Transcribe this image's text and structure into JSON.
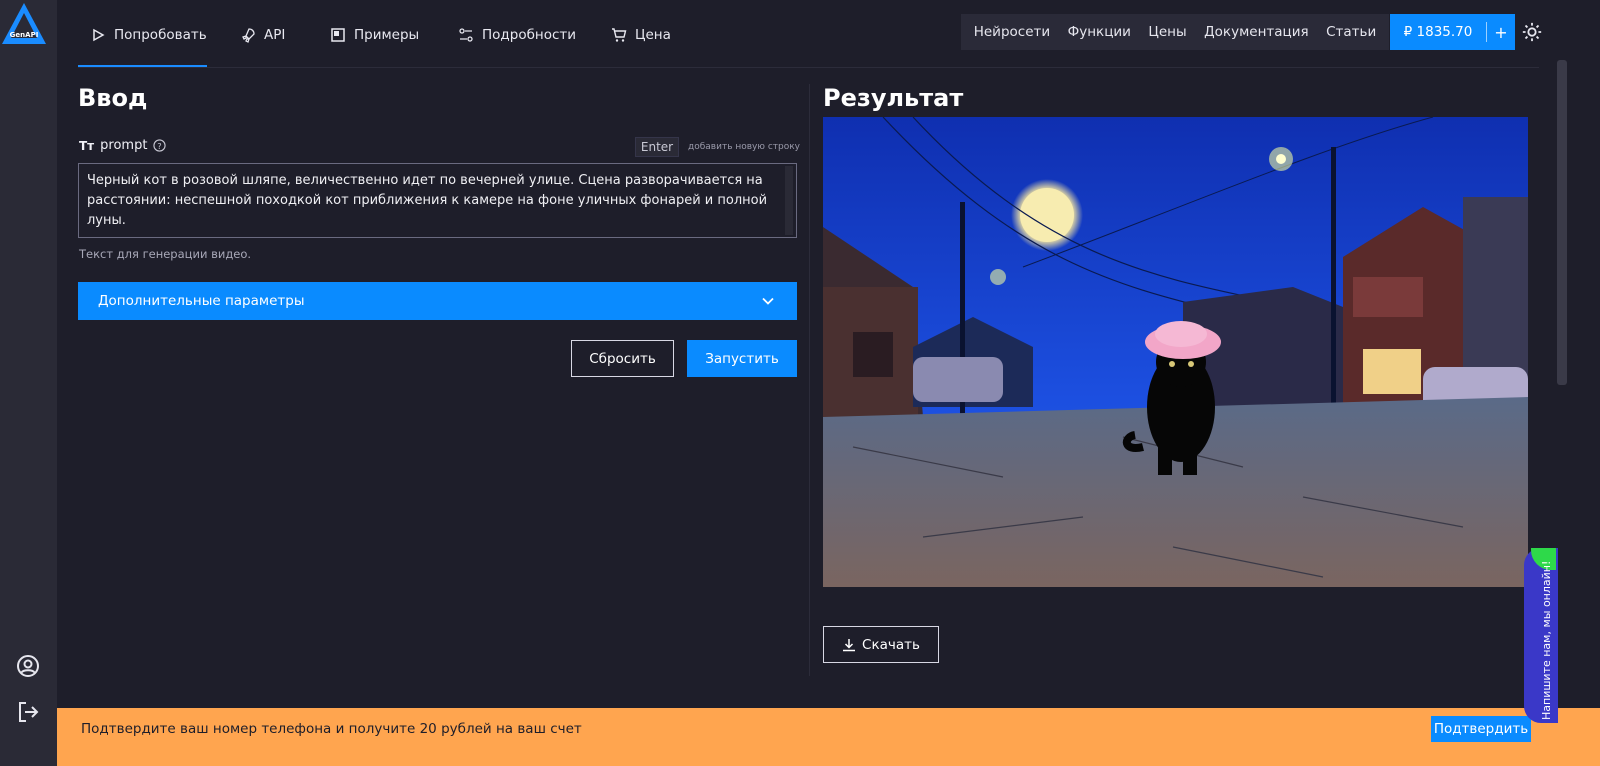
{
  "brand": {
    "logo_text": "GenAPI"
  },
  "nav": {
    "tabs": [
      {
        "label": "Попробовать",
        "icon": "play-icon"
      },
      {
        "label": "API",
        "icon": "rocket-icon"
      },
      {
        "label": "Примеры",
        "icon": "examples-icon"
      },
      {
        "label": "Подробности",
        "icon": "sliders-icon"
      },
      {
        "label": "Цена",
        "icon": "cart-icon"
      }
    ],
    "active_tab": "Попробовать"
  },
  "top_links": [
    "Нейросети",
    "Функции",
    "Цены",
    "Документация",
    "Статьи"
  ],
  "balance": {
    "value": "₽ 1835.70",
    "add_label": "+"
  },
  "input_panel": {
    "title": "Ввод",
    "prompt_label_prefix": "Tт",
    "prompt_label": "prompt",
    "enter_key": "Enter",
    "enter_hint": "добавить новую строку",
    "prompt_value": "Черный кот в розовой шляпе, величественно идет по вечерней улице. Сцена разворачивается на расстоянии: неспешной походкой кот приближения к камере на фоне уличных фонарей и полной луны.",
    "prompt_help": "Текст для генерации видео.",
    "extra_params_label": "Дополнительные параметры",
    "reset_label": "Сбросить",
    "run_label": "Запустить"
  },
  "result_panel": {
    "title": "Результат",
    "download_label": "Скачать"
  },
  "banner": {
    "text": "Подтвердите ваш номер телефона и получите 20 рублей на ваш счет",
    "confirm_label": "Подтвердить"
  },
  "chat_widget": {
    "text": "Напишите нам, мы онлайн!"
  },
  "colors": {
    "accent": "#0a8bff",
    "background": "#1e1e2a",
    "rail": "#2a2a36",
    "banner": "#ffa54f",
    "chat": "#3a38c8",
    "online": "#2ed94a"
  }
}
